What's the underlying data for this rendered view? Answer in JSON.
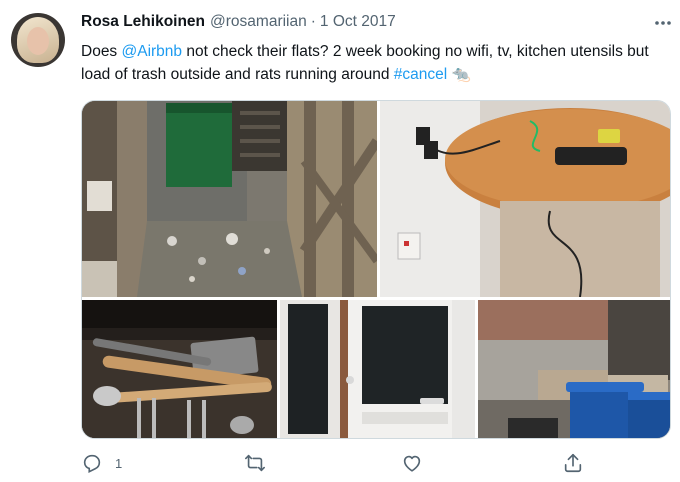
{
  "tweet": {
    "name": "Rosa Lehikoinen",
    "handle": "@rosamariian",
    "separator": "·",
    "date": "1 Oct 2017",
    "text_parts": {
      "p1": "Does ",
      "mention": "@Airbnb",
      "p2": " not check their flats? 2 week booking no wifi, tv, kitchen utensils but load of trash outside and rats running around ",
      "hashtag": "#cancel",
      "emoji": "🐀"
    },
    "reply_count": "1"
  },
  "icons": {
    "more": "more-horizontal-icon",
    "reply": "reply-icon",
    "retweet": "retweet-icon",
    "like": "like-icon",
    "share": "share-icon"
  },
  "colors": {
    "link": "#1d9bf0",
    "secondary_text": "#536471",
    "border": "#cfd9de"
  }
}
